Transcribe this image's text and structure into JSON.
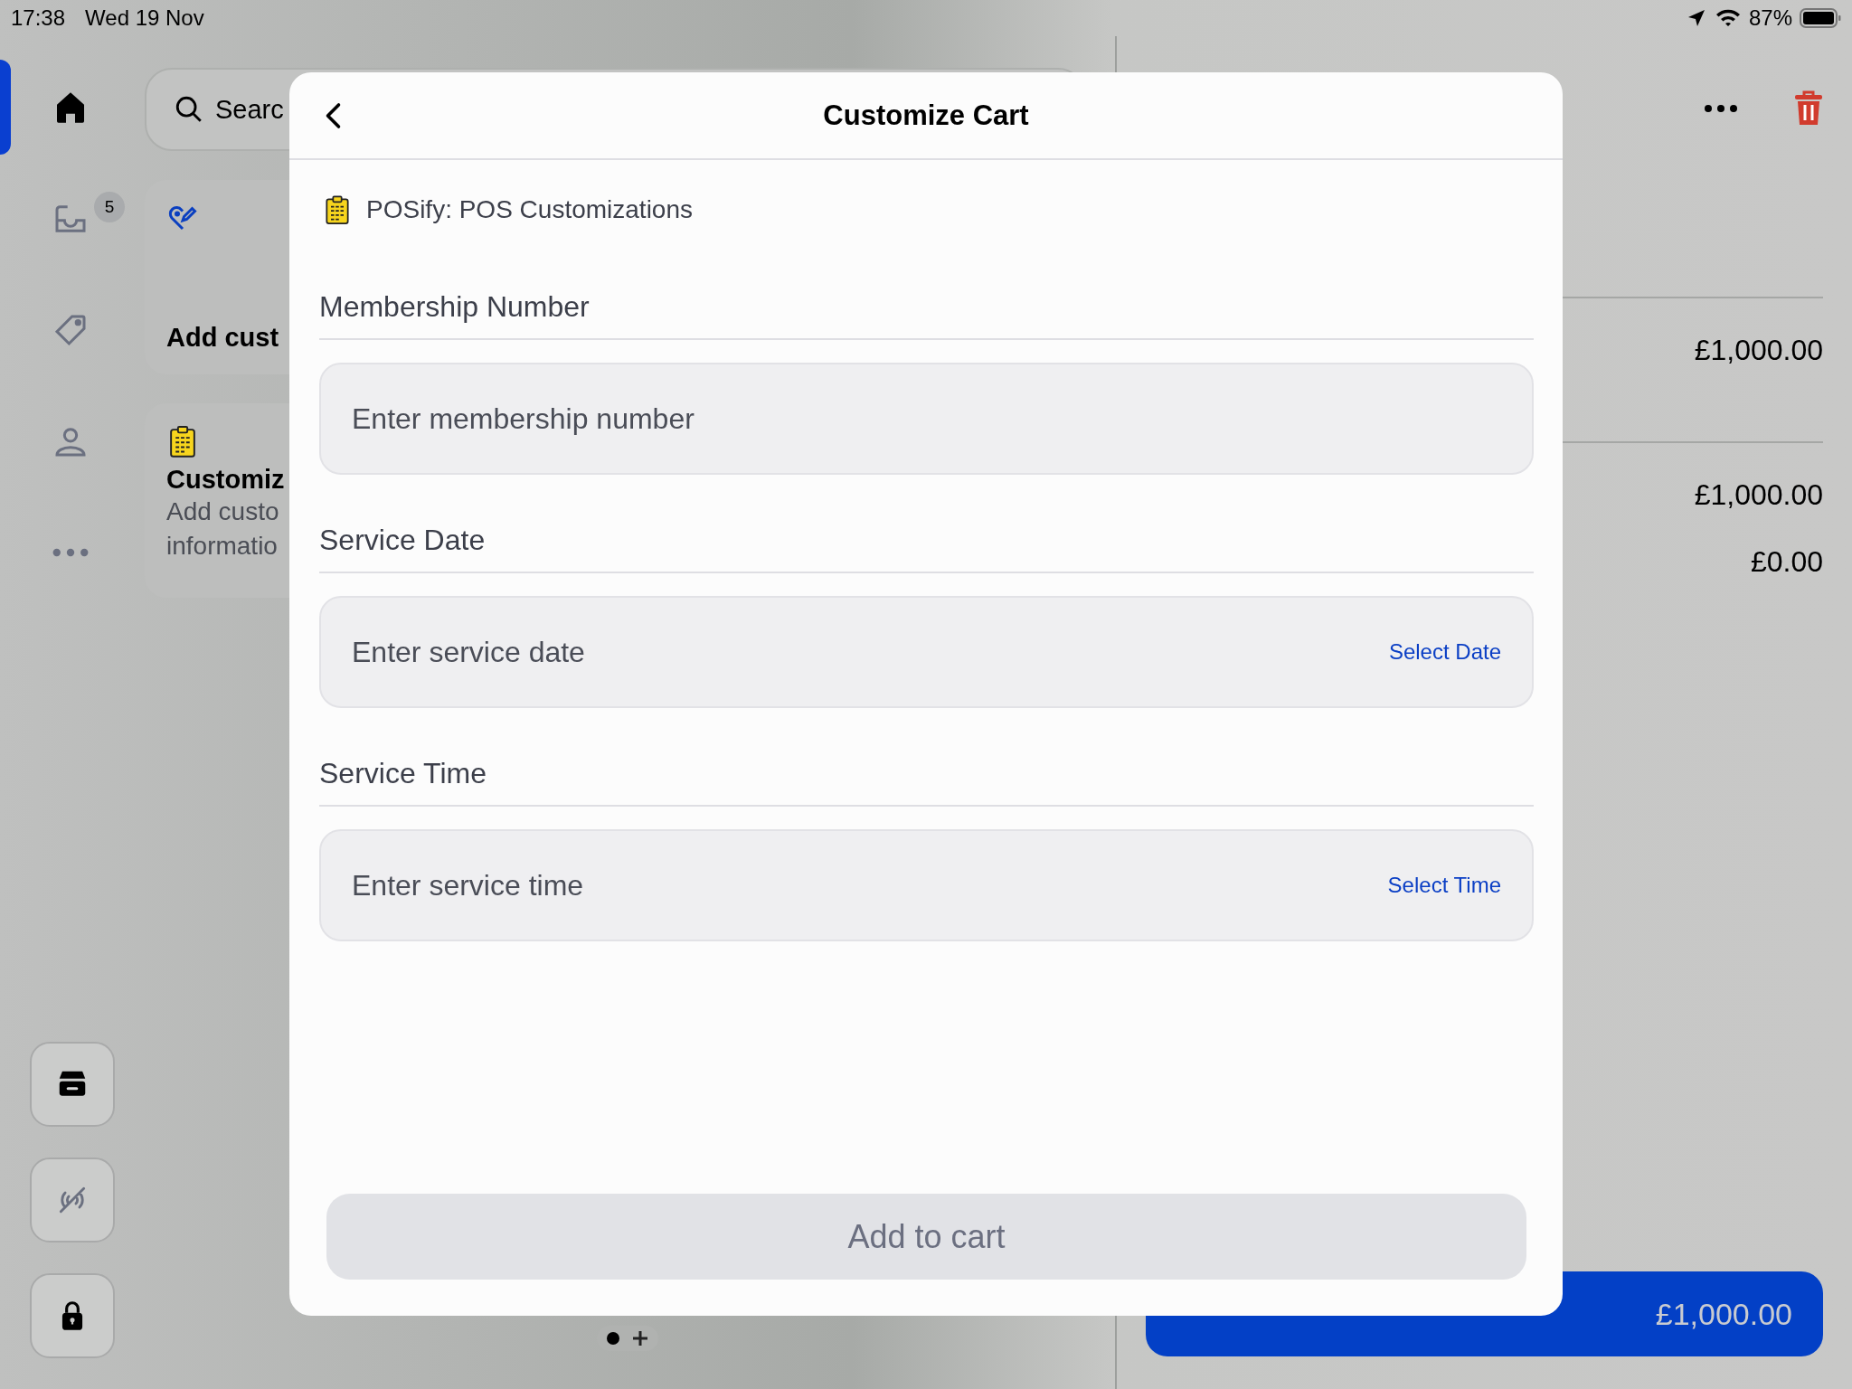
{
  "status_bar": {
    "time": "17:38",
    "date": "Wed 19 Nov",
    "battery": "87%"
  },
  "sidebar": {
    "items": [
      {
        "kind": "home",
        "selected": true
      },
      {
        "kind": "inbox",
        "badge": "5",
        "selected": false
      },
      {
        "kind": "tag",
        "selected": false
      },
      {
        "kind": "person",
        "selected": false
      },
      {
        "kind": "more",
        "selected": false
      }
    ],
    "bottom_buttons": [
      {
        "kind": "store"
      },
      {
        "kind": "no-signal"
      },
      {
        "kind": "lock"
      }
    ]
  },
  "search": {
    "placeholder": "Searc"
  },
  "tiles": [
    {
      "kind": "heart",
      "title": "Add cust"
    },
    {
      "kind": "clipboard",
      "title": "Customiz",
      "description": [
        "Add custo",
        "informatio"
      ]
    }
  ],
  "cart": {
    "amounts": [
      "£1,000.00",
      "£1,000.00",
      "£0.00"
    ],
    "checkout": {
      "total": "£1,000.00"
    }
  },
  "modal": {
    "title": "Customize Cart",
    "source": "POSify: POS Customizations",
    "fields": [
      {
        "label": "Membership Number",
        "placeholder": "Enter membership number"
      },
      {
        "label": "Service Date",
        "placeholder": "Enter service date",
        "action": "Select Date"
      },
      {
        "label": "Service Time",
        "placeholder": "Enter service time",
        "action": "Select Time"
      }
    ],
    "submit": {
      "label": "Add to cart",
      "disabled": true
    }
  }
}
